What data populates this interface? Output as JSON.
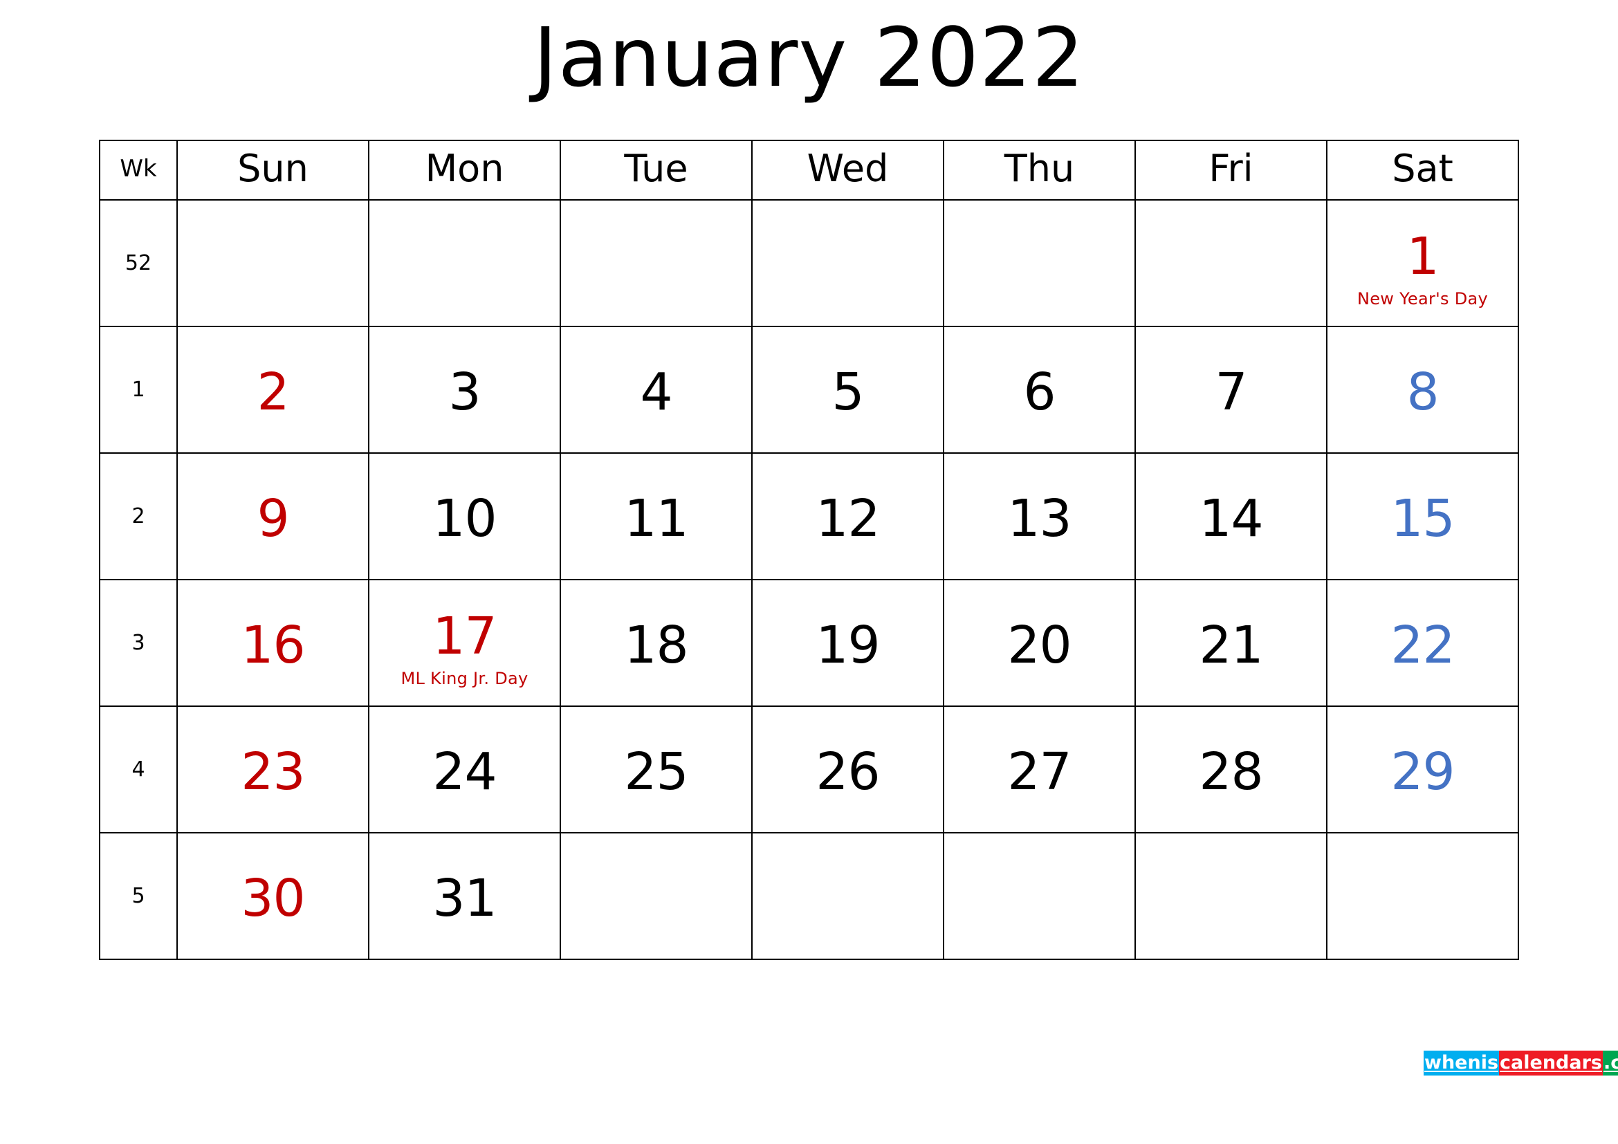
{
  "title": "January 2022",
  "colors": {
    "sunday": "#C00000",
    "saturday": "#4472C4",
    "weekday": "#000000",
    "holiday_text": "#C00000",
    "grid": "#000000",
    "background": "#FFFFFF",
    "logo_cyan": "#00AEEF",
    "logo_red": "#EE1C25",
    "logo_green": "#00A651"
  },
  "header": {
    "wk": "Wk",
    "days": [
      "Sun",
      "Mon",
      "Tue",
      "Wed",
      "Thu",
      "Fri",
      "Sat"
    ]
  },
  "weeks": [
    {
      "wk": "52",
      "days": [
        {
          "num": "",
          "holiday": ""
        },
        {
          "num": "",
          "holiday": ""
        },
        {
          "num": "",
          "holiday": ""
        },
        {
          "num": "",
          "holiday": ""
        },
        {
          "num": "",
          "holiday": ""
        },
        {
          "num": "",
          "holiday": ""
        },
        {
          "num": "1",
          "holiday": "New Year's Day"
        }
      ]
    },
    {
      "wk": "1",
      "days": [
        {
          "num": "2",
          "holiday": ""
        },
        {
          "num": "3",
          "holiday": ""
        },
        {
          "num": "4",
          "holiday": ""
        },
        {
          "num": "5",
          "holiday": ""
        },
        {
          "num": "6",
          "holiday": ""
        },
        {
          "num": "7",
          "holiday": ""
        },
        {
          "num": "8",
          "holiday": ""
        }
      ]
    },
    {
      "wk": "2",
      "days": [
        {
          "num": "9",
          "holiday": ""
        },
        {
          "num": "10",
          "holiday": ""
        },
        {
          "num": "11",
          "holiday": ""
        },
        {
          "num": "12",
          "holiday": ""
        },
        {
          "num": "13",
          "holiday": ""
        },
        {
          "num": "14",
          "holiday": ""
        },
        {
          "num": "15",
          "holiday": ""
        }
      ]
    },
    {
      "wk": "3",
      "days": [
        {
          "num": "16",
          "holiday": ""
        },
        {
          "num": "17",
          "holiday": "ML King Jr. Day"
        },
        {
          "num": "18",
          "holiday": ""
        },
        {
          "num": "19",
          "holiday": ""
        },
        {
          "num": "20",
          "holiday": ""
        },
        {
          "num": "21",
          "holiday": ""
        },
        {
          "num": "22",
          "holiday": ""
        }
      ]
    },
    {
      "wk": "4",
      "days": [
        {
          "num": "23",
          "holiday": ""
        },
        {
          "num": "24",
          "holiday": ""
        },
        {
          "num": "25",
          "holiday": ""
        },
        {
          "num": "26",
          "holiday": ""
        },
        {
          "num": "27",
          "holiday": ""
        },
        {
          "num": "28",
          "holiday": ""
        },
        {
          "num": "29",
          "holiday": ""
        }
      ]
    },
    {
      "wk": "5",
      "days": [
        {
          "num": "30",
          "holiday": ""
        },
        {
          "num": "31",
          "holiday": ""
        },
        {
          "num": "",
          "holiday": ""
        },
        {
          "num": "",
          "holiday": ""
        },
        {
          "num": "",
          "holiday": ""
        },
        {
          "num": "",
          "holiday": ""
        },
        {
          "num": "",
          "holiday": ""
        }
      ]
    }
  ],
  "watermark": {
    "part1": "whenis",
    "part2": "calendars",
    "part3": ".com"
  }
}
